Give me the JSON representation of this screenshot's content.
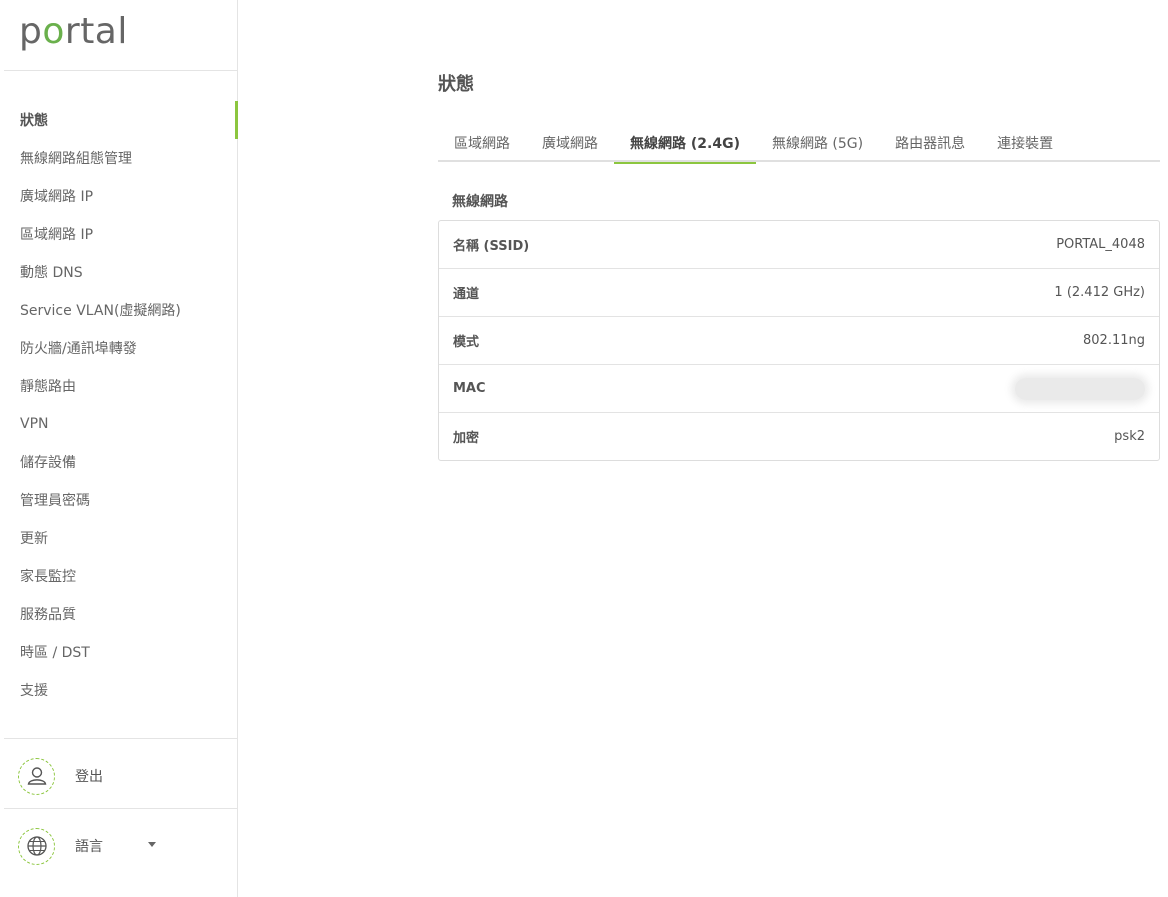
{
  "logo": {
    "text_pre": "p",
    "text_o": "o",
    "text_post": "rtal"
  },
  "sidebar": {
    "items": [
      {
        "label": "狀態",
        "active": true
      },
      {
        "label": "無線網路組態管理"
      },
      {
        "label": "廣域網路 IP"
      },
      {
        "label": "區域網路 IP"
      },
      {
        "label": "動態 DNS"
      },
      {
        "label": "Service VLAN(虛擬網路)"
      },
      {
        "label": "防火牆/通訊埠轉發"
      },
      {
        "label": "靜態路由"
      },
      {
        "label": "VPN"
      },
      {
        "label": "儲存設備"
      },
      {
        "label": "管理員密碼"
      },
      {
        "label": "更新"
      },
      {
        "label": "家長監控"
      },
      {
        "label": "服務品質"
      },
      {
        "label": "時區 / DST"
      },
      {
        "label": "支援"
      }
    ],
    "logout_label": "登出",
    "language_label": "語言",
    "logout_icon": "user-icon",
    "language_icon": "globe-icon"
  },
  "main": {
    "title": "狀態",
    "tabs": [
      {
        "label": "區域網路"
      },
      {
        "label": "廣域網路"
      },
      {
        "label": "無線網路 (2.4G)",
        "active": true
      },
      {
        "label": "無線網路 (5G)"
      },
      {
        "label": "路由器訊息"
      },
      {
        "label": "連接裝置"
      }
    ],
    "section_title": "無線網路",
    "rows": [
      {
        "label": "名稱 (SSID)",
        "value": "PORTAL_4048"
      },
      {
        "label": "通道",
        "value": "1 (2.412 GHz)"
      },
      {
        "label": "模式",
        "value": "802.11ng"
      },
      {
        "label": "MAC",
        "value": ""
      },
      {
        "label": "加密",
        "value": "psk2"
      }
    ]
  },
  "colors": {
    "accent": "#8cc63f",
    "text": "#555555",
    "border": "#e4e4e4"
  }
}
